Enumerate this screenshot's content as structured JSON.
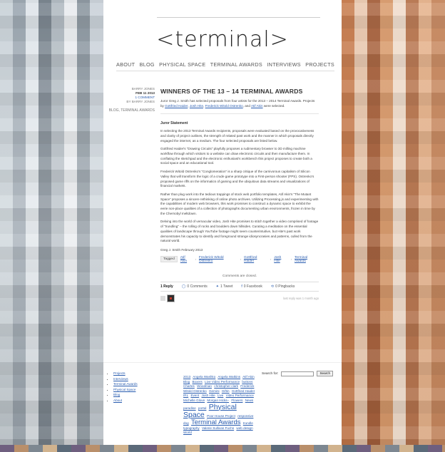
{
  "site": {
    "logo": "<terminal>"
  },
  "nav": [
    "ABOUT",
    "BLOG",
    "PHYSICAL SPACE",
    "TERMINAL AWARDS",
    "INTERVIEWS",
    "PROJECTS"
  ],
  "post": {
    "author": "BARRY JONES",
    "date": "FEB 11 2013",
    "comment_count": "1 COMMENT",
    "by_line": "BY BARRY JONES",
    "categories": "BLOG, TERMINAL AWARDS",
    "title": "WINNERS OF THE 13 – 14 TERMINAL AWARDS",
    "intro_text": "Juror Greg J. Smith  has selected proposals from four artists for the 2013 – 2014 Terminal Awards. Projects by",
    "intro_links": [
      "Gottfried Haider",
      "Josh Hite",
      "Frederick Witold Ostrenko",
      "Atif Akin"
    ],
    "intro_end": "were selected.",
    "jury_heading": "Juror Statement",
    "paragraphs": [
      "In selecting the 2013 Terminal Awards recipients, proposals were evaluated based on the provocativeness and clarity of project outlines, the strength of related past work and the manner in which proposals directly engaged the internet, as a medium. The four selected proposals are listed below.",
      "Gottfried Haider's “Drawing Circuits” playfully proposes a rudimentary browser to 3D milling machine workflow through which visitors to a website can draw electronic circuits and then manufacture them. In conflating the sketchpad and the electronic enthusiast's workbench this project proposes to create both a social space and an educational tool.",
      "Frederick Witold Ostrenko's “Conglomeration” is a sharp critique of the carnivorous capitalism of Silicon Valley that will transform the logic of a crude game prototype into a First-person shooter (FPS). Ostrenko's proposed game riffs on the informatics of gaming and the ubiquitous data streams and visualizations of financial markets.",
      "Rather than plug work into the tedious trappings of stock web portfolio templates, Atif Akin's “The Mutant Space” proposes a sincere rethinking of online photo archives. Utilizing Processing.js and experimenting with the capabilities of modern web browsers, this work promises to construct a dynamic space to exhibit the eerie non-place qualities of a collection of photographs documenting urban environments, frozen in time by the Chernobyl meltdown.",
      "Delving into the world of vernacular video, Josh Hite promises to stitch together a video comprised of footage of “trundling” – the rolling of rocks and boulders down hillsides. Curating a meditation on the essential qualities of landscape through YouTube footage might seem counterintuitive, but Hite's past work demonstrates his capacity to identify and foreground strange idiosyncrasies and patterns, culled from the natural world."
    ],
    "signature": "Greg J. Smith February 2013",
    "tags_label": "Tagged",
    "tags": [
      "Atif Akin",
      "Frederick Witold Ostrenko",
      "Gottfried Haider",
      "Josh Hite",
      "Terminal Awards"
    ]
  },
  "comments": {
    "closed_text": "Comments are closed.",
    "tabs": [
      "1 Reply",
      "0 Comments",
      "1 Tweet",
      "0 Facebook",
      "0 Pingbacks"
    ],
    "last_reply": "last reply was 1 month ago"
  },
  "footer": {
    "pages": [
      "Projects",
      "Interviews",
      "Terminal Awards",
      "Physical Space",
      "Blog",
      "About"
    ],
    "tag_cloud": [
      {
        "t": "2013",
        "s": "sm"
      },
      {
        "t": "Angela Washko",
        "s": "sm"
      },
      {
        "t": "Angela Watkins",
        "s": "sm"
      },
      {
        "t": "Atif Akin",
        "s": "sm"
      },
      {
        "t": "Blog",
        "s": "sm"
      },
      {
        "t": "Boxers",
        "s": "sm"
      },
      {
        "t": "Live Video Performance",
        "s": "sm"
      },
      {
        "t": "buttons",
        "s": "sm"
      },
      {
        "t": "Charles",
        "s": "sm"
      },
      {
        "t": "Woodman",
        "s": "sm"
      },
      {
        "t": "christopher clark",
        "s": "sm"
      },
      {
        "t": "Frederick Witold Ostrenko",
        "s": "sm"
      },
      {
        "t": "Gemini",
        "s": "sm"
      },
      {
        "t": "Giftin",
        "s": "sm"
      },
      {
        "t": "Gottfried Haider",
        "s": "sm"
      },
      {
        "t": "IRL",
        "s": "sm"
      },
      {
        "t": "Event",
        "s": "sm"
      },
      {
        "t": "Josh Hite",
        "s": "sm"
      },
      {
        "t": "Live",
        "s": "sm"
      },
      {
        "t": "Video Performance",
        "s": "sm"
      },
      {
        "t": "Michelle Glove",
        "s": "sm"
      },
      {
        "t": "Morgan Hicks–",
        "s": "sm"
      },
      {
        "t": "Flowers",
        "s": "sm"
      },
      {
        "t": "News",
        "s": "sm"
      },
      {
        "t": "paradise",
        "s": "sm"
      },
      {
        "t": "portal",
        "s": "sm"
      },
      {
        "t": "Physical",
        "s": "xl"
      },
      {
        "t": "Space",
        "s": "xl"
      },
      {
        "t": "Poor House Project",
        "s": "sm"
      },
      {
        "t": "responsive",
        "s": "sm"
      },
      {
        "t": "dog",
        "s": "sm"
      },
      {
        "t": "Terminal Awards",
        "s": "lg"
      },
      {
        "t": "trundle",
        "s": "sm"
      },
      {
        "t": "typography",
        "s": "sm"
      },
      {
        "t": "Valerie Sullivan Fuchs",
        "s": "sm"
      },
      {
        "t": "web design",
        "s": "sm"
      },
      {
        "t": "World",
        "s": "sm"
      }
    ],
    "search_label": "Search for:",
    "search_placeholder": "",
    "search_button": "Search"
  }
}
